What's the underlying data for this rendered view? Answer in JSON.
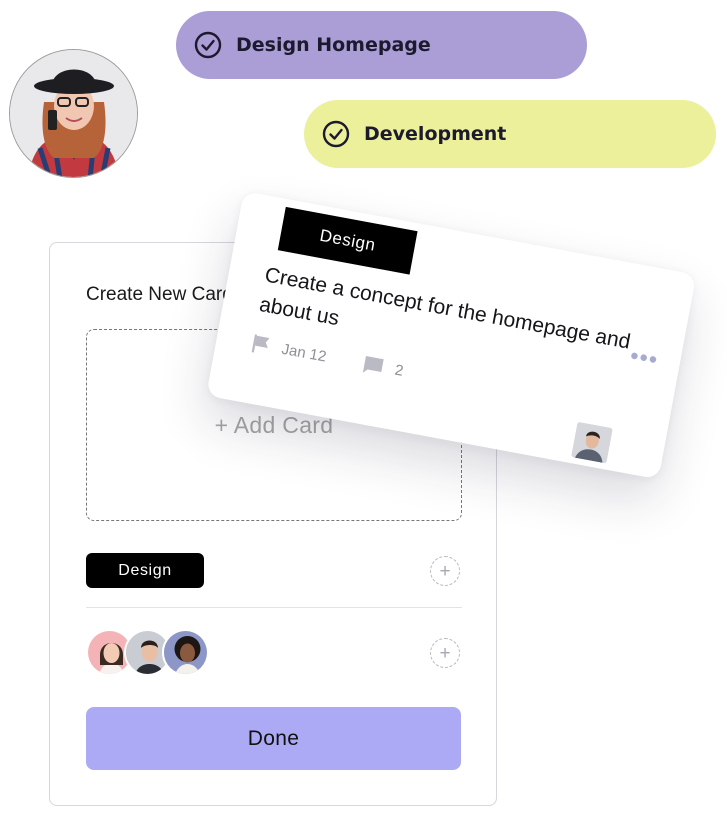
{
  "pills": {
    "design_homepage": {
      "label": "Design Homepage",
      "color": "#ab9dd6"
    },
    "development": {
      "label": "Development",
      "color": "#ecf09b"
    }
  },
  "profile": {
    "icon": "profile-avatar"
  },
  "panel": {
    "title": "Create New Card",
    "add_card_label": "+ Add Card",
    "tag_label": "Design",
    "add_tag_icon": "plus-circle-icon",
    "add_member_icon": "plus-circle-icon",
    "done_label": "Done",
    "done_color": "#acaaf5"
  },
  "task": {
    "tag": "Design",
    "title": "Create a concept for the homepage and about us",
    "date": "Jan 12",
    "comments": "2",
    "menu_icon": "more-dots-icon"
  }
}
